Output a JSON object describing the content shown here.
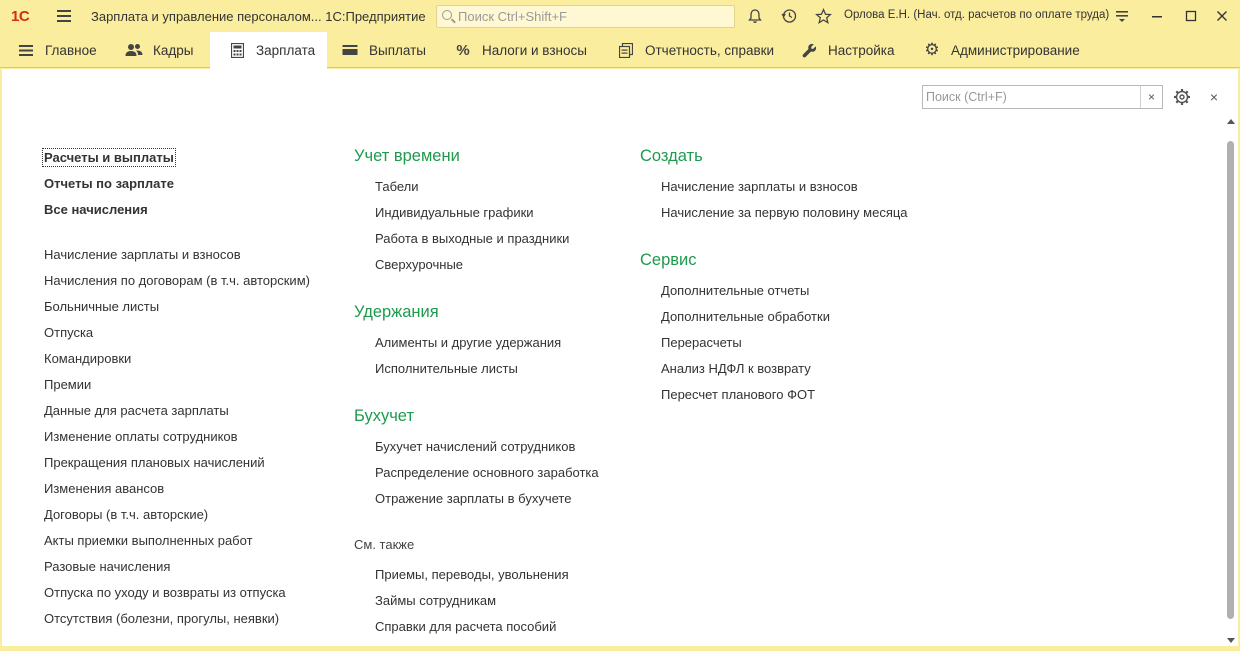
{
  "window": {
    "logo": "1С",
    "title": "Зарплата и управление персоналом... 1С:Предприятие",
    "search_placeholder": "Поиск Ctrl+Shift+F",
    "user": "Орлова Е.Н. (Нач. отд. расчетов по оплате труда)"
  },
  "menu": [
    {
      "label": "Главное",
      "icon": "hamburger-icon"
    },
    {
      "label": "Кадры",
      "icon": "people-icon"
    },
    {
      "label": "Зарплата",
      "icon": "calculator-icon",
      "active": true
    },
    {
      "label": "Выплаты",
      "icon": "wallet-icon"
    },
    {
      "label": "Налоги и взносы",
      "icon": "percent-icon"
    },
    {
      "label": "Отчетность, справки",
      "icon": "documents-icon"
    },
    {
      "label": "Настройка",
      "icon": "wrench-icon"
    },
    {
      "label": "Администрирование",
      "icon": "gear-icon"
    }
  ],
  "panel": {
    "search_placeholder": "Поиск (Ctrl+F)",
    "clear": "×",
    "close": "×"
  },
  "column1": {
    "main_links": [
      "Расчеты и выплаты",
      "Отчеты по зарплате",
      "Все начисления"
    ],
    "links": [
      "Начисление зарплаты и взносов",
      "Начисления по договорам (в т.ч. авторским)",
      "Больничные листы",
      "Отпуска",
      "Командировки",
      "Премии",
      "Данные для расчета зарплаты",
      "Изменение оплаты сотрудников",
      "Прекращения плановых начислений",
      "Изменения авансов",
      "Договоры (в т.ч. авторские)",
      "Акты приемки выполненных работ",
      "Разовые начисления",
      "Отпуска по уходу и возвраты из отпуска",
      "Отсутствия (болезни, прогулы, неявки)"
    ]
  },
  "column2": {
    "groups": [
      {
        "title": "Учет времени",
        "items": [
          "Табели",
          "Индивидуальные графики",
          "Работа в выходные и праздники",
          "Сверхурочные"
        ]
      },
      {
        "title": "Удержания",
        "items": [
          "Алименты и другие удержания",
          "Исполнительные листы"
        ]
      },
      {
        "title": "Бухучет",
        "items": [
          "Бухучет начислений сотрудников",
          "Распределение основного заработка",
          "Отражение зарплаты в бухучете"
        ]
      }
    ],
    "see_also_title": "См. также",
    "see_also": [
      "Приемы, переводы, увольнения",
      "Займы сотрудникам",
      "Справки для расчета пособий"
    ]
  },
  "column3": {
    "groups": [
      {
        "title": "Создать",
        "items": [
          "Начисление зарплаты и взносов",
          "Начисление за первую половину месяца"
        ]
      },
      {
        "title": "Сервис",
        "items": [
          "Дополнительные отчеты",
          "Дополнительные обработки",
          "Перерасчеты",
          "Анализ НДФЛ к возврату",
          "Пересчет планового ФОТ"
        ]
      }
    ]
  }
}
